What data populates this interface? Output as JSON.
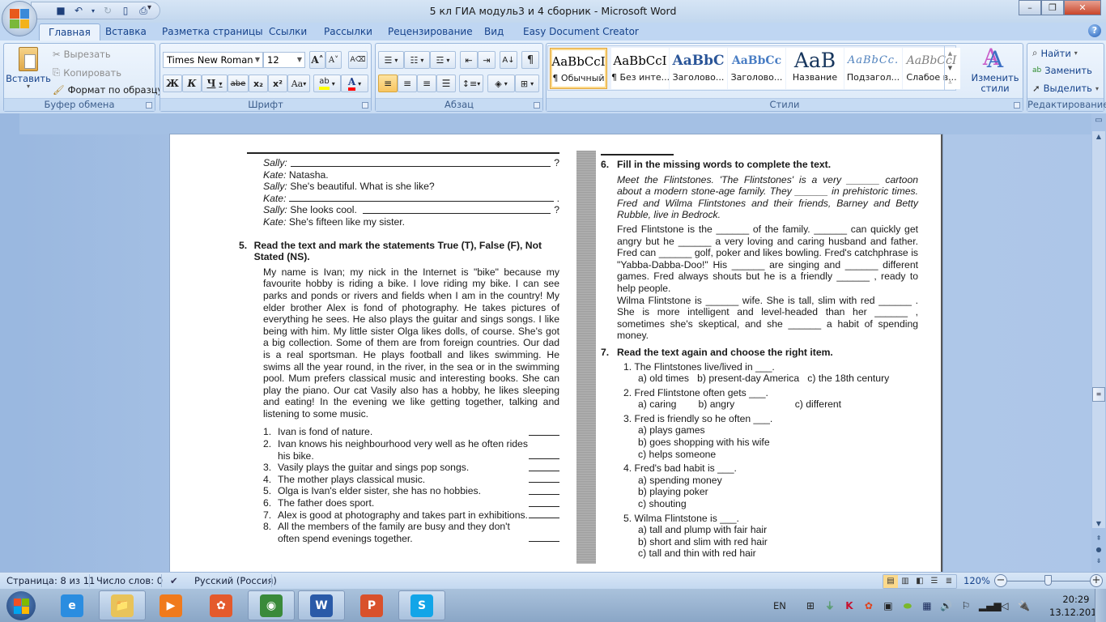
{
  "window": {
    "title": "5 кл ГИА модуль3 и 4 сборник - Microsoft Word",
    "controls": {
      "minimize": "–",
      "restore": "❐",
      "close": "✕"
    }
  },
  "quick_access": [
    {
      "name": "save-icon",
      "glyph": "💾"
    },
    {
      "name": "undo-icon",
      "glyph": "↶"
    },
    {
      "name": "redo-icon",
      "glyph": "↻"
    },
    {
      "name": "new-document-icon",
      "glyph": "🗋"
    },
    {
      "name": "print-icon",
      "glyph": "🖶"
    }
  ],
  "tabs": [
    "Главная",
    "Вставка",
    "Разметка страницы",
    "Ссылки",
    "Рассылки",
    "Рецензирование",
    "Вид",
    "Easy Document Creator"
  ],
  "active_tab": "Главная",
  "ribbon": {
    "clipboard": {
      "label": "Буфер обмена",
      "paste": "Вставить",
      "cut": "Вырезать",
      "copy": "Копировать",
      "format_painter": "Формат по образцу"
    },
    "font": {
      "label": "Шрифт",
      "font_name": "Times New Roman",
      "font_size": "12",
      "bold": "Ж",
      "italic": "К",
      "underline": "Ч",
      "strikethrough": "abe",
      "subscript": "x₂",
      "superscript": "x²",
      "change_case": "Aa",
      "grow": "A˄",
      "shrink": "A˅",
      "clear": "A⌫",
      "highlight_color": "#ffff00",
      "font_color": "#ff0000"
    },
    "paragraph": {
      "label": "Абзац"
    },
    "styles": {
      "label": "Стили",
      "items": [
        {
          "preview": "AaBbCcI",
          "name": "¶ Обычный",
          "selected": true
        },
        {
          "preview": "AaBbCcI",
          "name": "¶ Без инте..."
        },
        {
          "preview": "AaBbC",
          "name": "Заголово..."
        },
        {
          "preview": "AaBbCc",
          "name": "Заголово..."
        },
        {
          "preview": "AaB",
          "name": "Название"
        },
        {
          "preview": "AaBbCc.",
          "name": "Подзагол..."
        },
        {
          "preview": "AaBbCcI",
          "name": "Слабое в..."
        }
      ],
      "change_styles": "Изменить стили"
    },
    "editing": {
      "label": "Редактирование",
      "find": "Найти",
      "replace": "Заменить",
      "select": "Выделить"
    }
  },
  "document": {
    "dialogue": [
      {
        "speaker": "Sally:",
        "text": "",
        "blank": true,
        "end": "?"
      },
      {
        "speaker": "Kate:",
        "text": "Natasha."
      },
      {
        "speaker": "Sally:",
        "text": "She's beautiful. What is she like?"
      },
      {
        "speaker": "Kate:",
        "text": "",
        "blank": true,
        "end": "."
      },
      {
        "speaker": "Sally:",
        "text": "She looks cool.",
        "blank": true,
        "end": "?"
      },
      {
        "speaker": "Kate:",
        "text": "She's fifteen like my sister."
      }
    ],
    "ex5": {
      "num": "5.",
      "title": "Read the text and mark the statements True (T), False (F), Not Stated (NS).",
      "text": "My name is Ivan; my nick in the Internet is \"bike\" because my favourite hobby is riding a bike. I love riding my bike. I can see parks and ponds or rivers and fields when I am in the country! My elder brother Alex is fond of photography. He takes pictures of everything he sees. He also plays the guitar and sings songs. I like being with him. My little sister Olga likes dolls, of course. She's got a big collection. Some of them are from foreign countries. Our dad is a real sportsman. He plays football and likes swimming. He swims all the year round, in the river, in the sea or in the swimming pool. Mum prefers classical music and interesting books. She can play the piano. Our cat Vasily also has a hobby, he likes sleeping and eating! In the evening we like getting together, talking and listening to some music.",
      "statements": [
        "Ivan is fond of nature.",
        "Ivan knows his neighbourhood very well as he often rides his bike.",
        "Vasily plays the guitar and sings pop songs.",
        "The mother plays classical music.",
        "Olga is Ivan's elder sister, she has no hobbies.",
        "The father does sport.",
        "Alex is good at photography and takes part in exhibitions.",
        "All the members of the family are busy and they don't often spend evenings together."
      ]
    },
    "ex6": {
      "num": "6.",
      "title": "Fill in the missing words to complete the text.",
      "intro": "Meet the Flintstones. 'The Flintstones' is a very ______ cartoon about a modern stone-age family. They ______ in prehistoric times. Fred and Wilma Flintstones and their friends, Barney and Betty Rubble, live in Bedrock.",
      "p1": "Fred Flintstone is the ______ of the family. ______ can quickly get angry but he ______ a very loving and caring husband and father. Fred can ______ golf, poker and likes bowling. Fred's catchphrase is \"Yabba-Dabba-Doo!\" His ______ are singing and ______ different games. Fred always shouts but he is a friendly ______ , ready to help people.",
      "p2": "Wilma Flintstone is ______ wife. She is tall, slim with red ______ . She is more intelligent and level-headed than her ______ , sometimes she's skeptical, and she ______ a habit of spending money."
    },
    "ex7": {
      "num": "7.",
      "title": "Read the text again and choose the right item.",
      "questions": [
        {
          "q": "1. The Flintstones live/lived in ___.",
          "opts": [
            "a) old times   b) present-day America   c) the 18th century"
          ]
        },
        {
          "q": "2. Fred Flintstone often gets ___.",
          "opts": [
            "a) caring        b) angry                      c) different"
          ]
        },
        {
          "q": "3. Fred is friendly so he often ___.",
          "opts": [
            "a) plays games",
            "b) goes shopping with his wife",
            "c) helps someone"
          ]
        },
        {
          "q": "4. Fred's bad habit is ___.",
          "opts": [
            "a) spending money",
            "b) playing poker",
            "c) shouting"
          ]
        },
        {
          "q": "5. Wilma Flintstone is ___.",
          "opts": [
            "a) tall and plump with fair hair",
            "b) short and slim with red hair",
            "c) tall and thin with red hair"
          ]
        }
      ]
    }
  },
  "statusbar": {
    "page": "Страница: 8 из 11",
    "words": "Число слов: 0",
    "language": "Русский (Россия)",
    "zoom": "120%",
    "zoom_percent": 120
  },
  "taskbar": {
    "apps": [
      {
        "name": "internet-explorer",
        "glyph": "e",
        "color": "#2b8de0",
        "open": false
      },
      {
        "name": "file-explorer",
        "glyph": "📁",
        "color": "#e8c35a",
        "open": true
      },
      {
        "name": "media-player",
        "glyph": "▶",
        "color": "#f07a1c",
        "open": false
      },
      {
        "name": "photo-gallery",
        "glyph": "✿",
        "color": "#e45a2c",
        "open": false
      },
      {
        "name": "chrome",
        "glyph": "◉",
        "color": "#3a8a3a",
        "open": true
      },
      {
        "name": "word",
        "glyph": "W",
        "color": "#2a5aa8",
        "open": true
      },
      {
        "name": "powerpoint",
        "glyph": "P",
        "color": "#d9512c",
        "open": false
      },
      {
        "name": "skype",
        "glyph": "S",
        "color": "#12a5e8",
        "open": true
      }
    ],
    "language": "EN",
    "time": "20:29",
    "date": "13.12.2015"
  }
}
